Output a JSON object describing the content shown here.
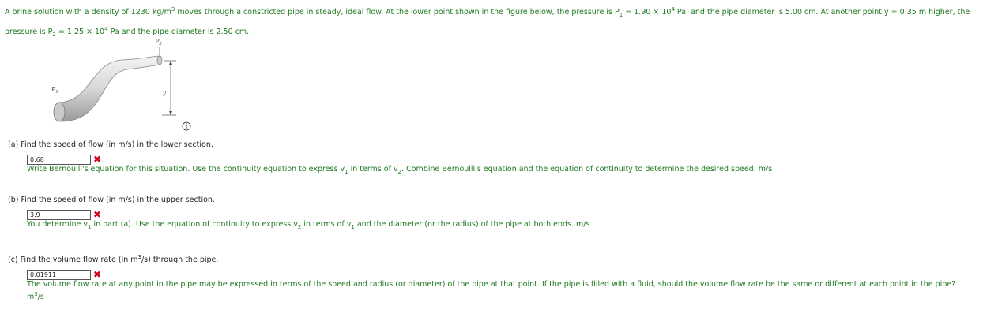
{
  "problem": {
    "t1": "A brine solution with a density of 1230 kg/m",
    "sup3": "3",
    "t2": " moves through a constricted pipe in steady, ideal flow. At the lower point shown in the figure below, the pressure is P",
    "sub1": "1",
    "t3": " = 1.90 × 10",
    "supA": "4",
    "t4": " Pa, and the pipe diameter is 5.00 cm. At another point y = 0.35 m higher, the pressure is P",
    "sub2": "2",
    "t5": " = 1.25 × 10",
    "supB": "4",
    "t6": " Pa and the pipe diameter is 2.50 cm."
  },
  "figure": {
    "p2_label": "P",
    "p2_sub": "2",
    "p1_label": "P",
    "p1_sub": "1",
    "y_label": "y",
    "info_icon": "info-circle-icon"
  },
  "parts": {
    "a": {
      "question": "(a)   Find the speed of flow (in m/s) in the lower section.",
      "answer": "0.68",
      "mark": "✖",
      "fb1": "Write Bernoulli's equation for this situation. Use the continuity equation to express v",
      "fb_sub1": "1",
      "fb2": " in terms of v",
      "fb_sub2": "2",
      "fb3": ". Combine Bernoulli's equation and the equation of continuity to determine the desired speed. m/s"
    },
    "b": {
      "question": "(b)   Find the speed of flow (in m/s) in the upper section.",
      "answer": "3.9",
      "mark": "✖",
      "fb1": "You determine v",
      "fb_sub1": "1",
      "fb2": " in part (a). Use the equation of continuity to express v",
      "fb_sub2": "2",
      "fb3": " in terms of v",
      "fb_sub3": "1",
      "fb4": " and the diameter (or the radius) of the pipe at both ends. m/s"
    },
    "c": {
      "q1": "(c)   Find the volume flow rate (in m",
      "q_sup": "3",
      "q2": "/s) through the pipe.",
      "answer": "0.01911",
      "mark": "✖",
      "fb1": "The volume flow rate at any point in the pipe may be expressed in terms of the speed and radius (or diameter) of the pipe at that point. If the pipe is filled with a fluid, should the volume flow rate be the same or different at each point in the pipe?",
      "unit": "m",
      "unit_sup": "3",
      "unit2": "/s"
    }
  },
  "colors": {
    "feedback_green": "#1f7a1f",
    "error_red": "#d0021b"
  }
}
